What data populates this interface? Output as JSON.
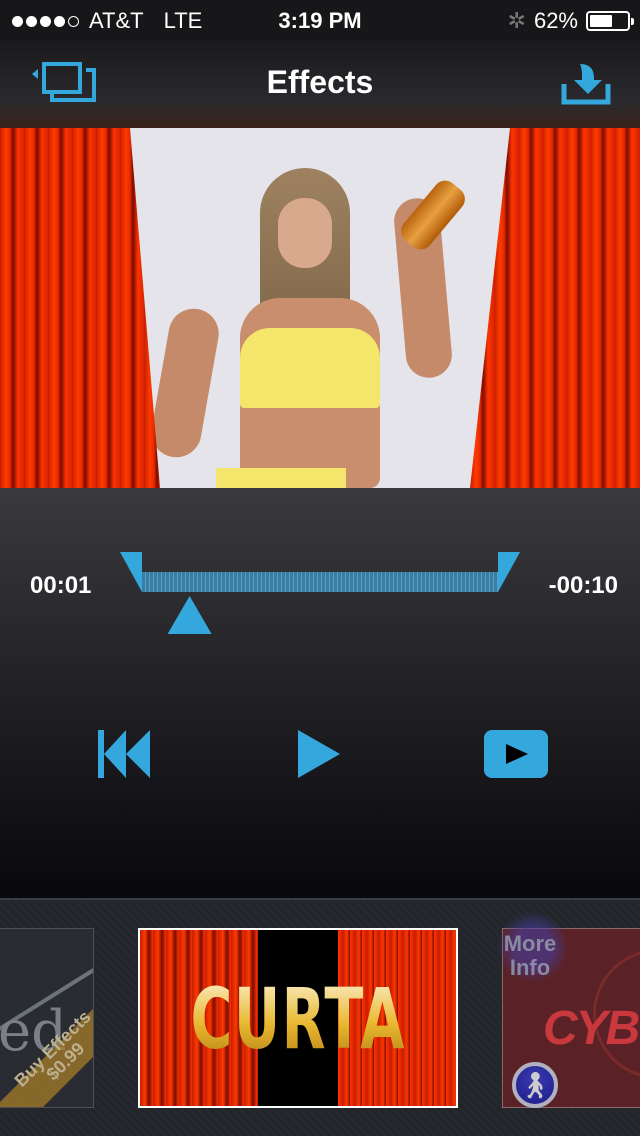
{
  "status_bar": {
    "signal_bars_filled": 4,
    "signal_bars_total": 5,
    "carrier": "AT&T",
    "network": "LTE",
    "time": "3:19 PM",
    "bluetooth_icon": "bluetooth-icon",
    "battery_percent": "62%",
    "battery_level": 0.62
  },
  "nav": {
    "title": "Effects",
    "left_icon": "back-to-projects-icon",
    "right_icon": "download-icon"
  },
  "preview": {
    "description": "Video frame with red stage curtains framing a woman holding a bottle"
  },
  "trim": {
    "elapsed": "00:01",
    "remaining": "-00:10",
    "playhead_fraction": 0.1,
    "accent_color": "#34a8dc"
  },
  "controls": {
    "rewind_icon": "skip-to-start-icon",
    "play_icon": "play-icon",
    "preview_icon": "preview-play-icon"
  },
  "effects_tray": {
    "items": [
      {
        "name": "previous-effect",
        "logo_text": "ed",
        "ribbon_text": "Buy Effects $0.99"
      },
      {
        "name": "curtain",
        "title": "CURTAIN",
        "selected": true
      },
      {
        "name": "cyber",
        "title": "CYB",
        "more_info": "More Info",
        "badge_icon": "walking-person-icon"
      }
    ]
  }
}
